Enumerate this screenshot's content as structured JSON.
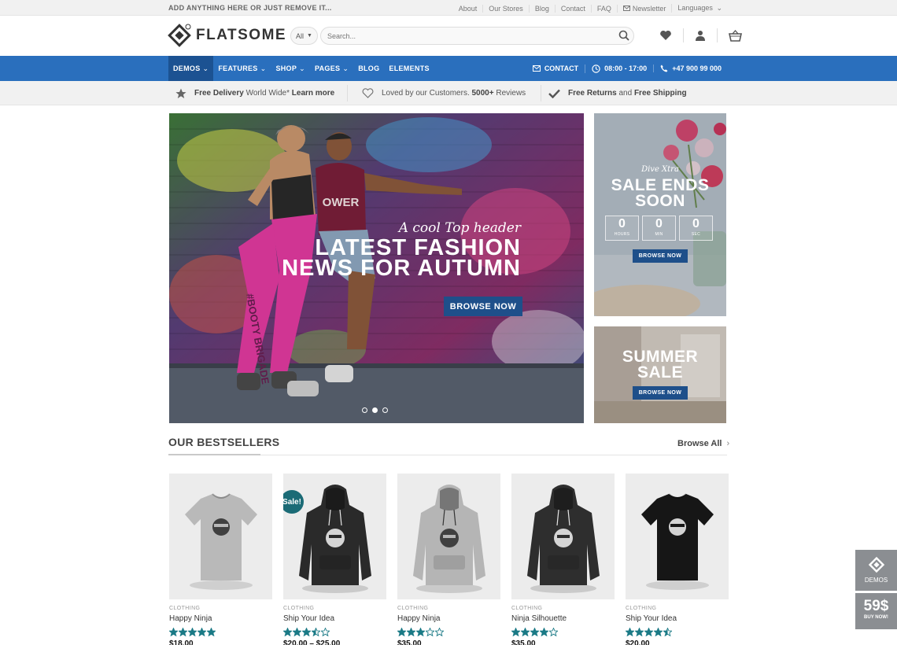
{
  "topbar": {
    "promo": "ADD ANYTHING HERE OR JUST REMOVE IT...",
    "links": [
      "About",
      "Our Stores",
      "Blog",
      "Contact",
      "FAQ"
    ],
    "newsletter": "Newsletter",
    "languages": "Languages"
  },
  "header": {
    "logo": "FLATSOME",
    "category": "All",
    "search_placeholder": "Search..."
  },
  "nav": {
    "items": [
      "DEMOS",
      "FEATURES",
      "SHOP",
      "PAGES",
      "BLOG",
      "ELEMENTS"
    ],
    "contact": "CONTACT",
    "hours": "08:00 - 17:00",
    "phone": "+47 900 99 000"
  },
  "usp": {
    "u1_bold": "Free Delivery",
    "u1_text": " World Wide*",
    "u1_link": "Learn more",
    "u2_text": "Loved by our Customers.",
    "u2_bold": "5000+",
    "u2_after": " Reviews",
    "u3_bold1": "Free Returns",
    "u3_mid": " and ",
    "u3_bold2": "Free Shipping"
  },
  "hero": {
    "tagline": "A cool Top header",
    "line1": "LATEST FASHION",
    "line2": "NEWS FOR AUTUMN",
    "button": "BROWSE NOW",
    "shirt_text": "OWER",
    "leg_text": "#BOOTY BRIGADE"
  },
  "side1": {
    "script": "Dive Xtra",
    "title1": "SALE ENDS",
    "title2": "SOON",
    "countdown": [
      {
        "n": "0",
        "l": "HOURS"
      },
      {
        "n": "0",
        "l": "MIN"
      },
      {
        "n": "0",
        "l": "SEC"
      }
    ],
    "button": "BROWSE NOW"
  },
  "side2": {
    "title1": "SUMMER",
    "title2": "SALE",
    "button": "BROWSE NOW"
  },
  "bestsellers": {
    "title": "OUR BESTSELLERS",
    "browse": "Browse All",
    "products": [
      {
        "cat": "CLOTHING",
        "name": "Happy Ninja",
        "price": "$18.00",
        "rating": 5,
        "type": "tee",
        "color": "#b9b9b9",
        "sale": false
      },
      {
        "cat": "CLOTHING",
        "name": "Ship Your Idea",
        "price": "$20.00 – $25.00",
        "rating": 3.5,
        "type": "hoodie",
        "color": "#2a2a2a",
        "sale": true
      },
      {
        "cat": "CLOTHING",
        "name": "Happy Ninja",
        "price": "$35.00",
        "rating": 3,
        "type": "hoodie",
        "color": "#b5b5b5",
        "sale": false
      },
      {
        "cat": "CLOTHING",
        "name": "Ninja Silhouette",
        "price": "$35.00",
        "rating": 4,
        "type": "hoodie",
        "color": "#2e2e2e",
        "sale": false
      },
      {
        "cat": "CLOTHING",
        "name": "Ship Your Idea",
        "price": "$20.00",
        "rating": 4.5,
        "type": "tee",
        "color": "#161616",
        "sale": false
      }
    ],
    "sale_label": "Sale!"
  },
  "widgets": {
    "demos": "DEMOS",
    "price": "59$",
    "buy": "BUY NOW!"
  },
  "colors": {
    "nav": "#2a6fbd",
    "nav_active": "#1c5292",
    "button": "#1e4f8a",
    "star": "#1b7a86",
    "sale": "#1b6b76"
  }
}
